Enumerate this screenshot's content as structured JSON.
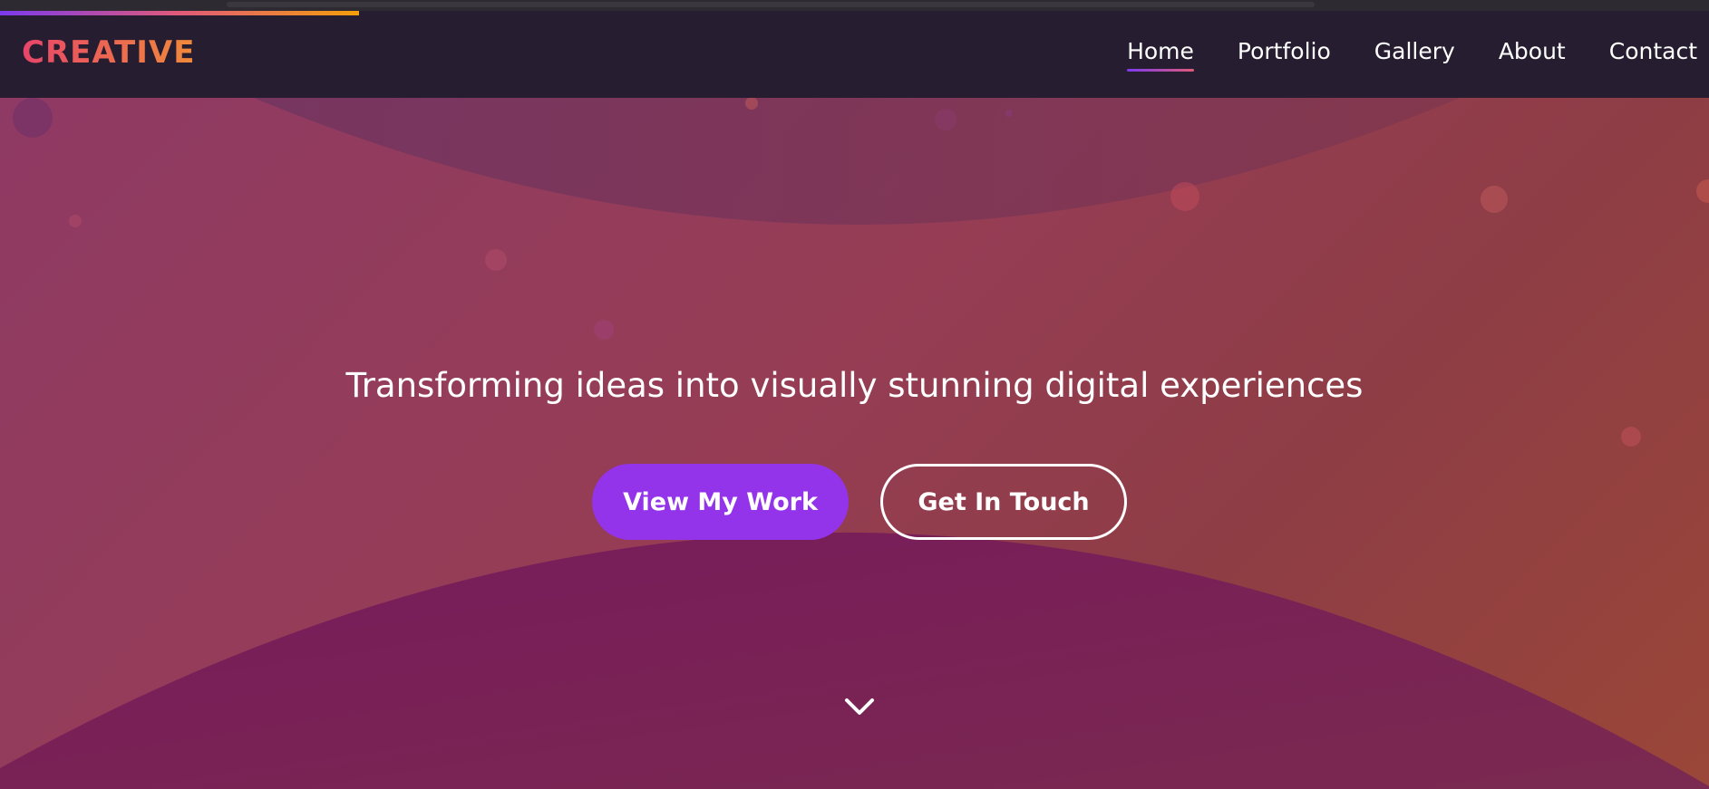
{
  "nav": {
    "logo": "CREATIVE",
    "links": [
      {
        "label": "Home",
        "active": true
      },
      {
        "label": "Portfolio",
        "active": false
      },
      {
        "label": "Gallery",
        "active": false
      },
      {
        "label": "About",
        "active": false
      },
      {
        "label": "Contact",
        "active": false
      }
    ]
  },
  "scroll_progress": 0.21,
  "hero": {
    "tagline": "Transforming ideas into visually stunning digital experiences",
    "primary_button": "View My Work",
    "secondary_button": "Get In Touch",
    "scroll_icon": "chevron-down-icon"
  },
  "colors": {
    "accent": "#9333ea",
    "logo_gradient_start": "#e8456a",
    "logo_gradient_end": "#f08a3a",
    "navbar_bg": "#261d30"
  }
}
